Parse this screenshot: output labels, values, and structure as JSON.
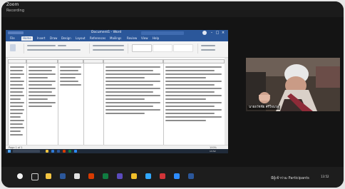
{
  "zoom": {
    "meeting_label": "Zoom",
    "sub_label": "Recording",
    "participant_name": "นายธวัชชัย ศรีใจนวล",
    "bottom_host_label": "มีผู้เข้าร่วม Participants",
    "tray_time": "13:52"
  },
  "word": {
    "doc_title": "Document1 - Word",
    "menu_tabs": [
      "File",
      "Home",
      "Insert",
      "Draw",
      "Design",
      "Layout",
      "References",
      "Mailings",
      "Review",
      "View",
      "Help"
    ],
    "status_left": "Page 1 of 1",
    "status_right": "100%",
    "taskbar_time": "13:52"
  }
}
